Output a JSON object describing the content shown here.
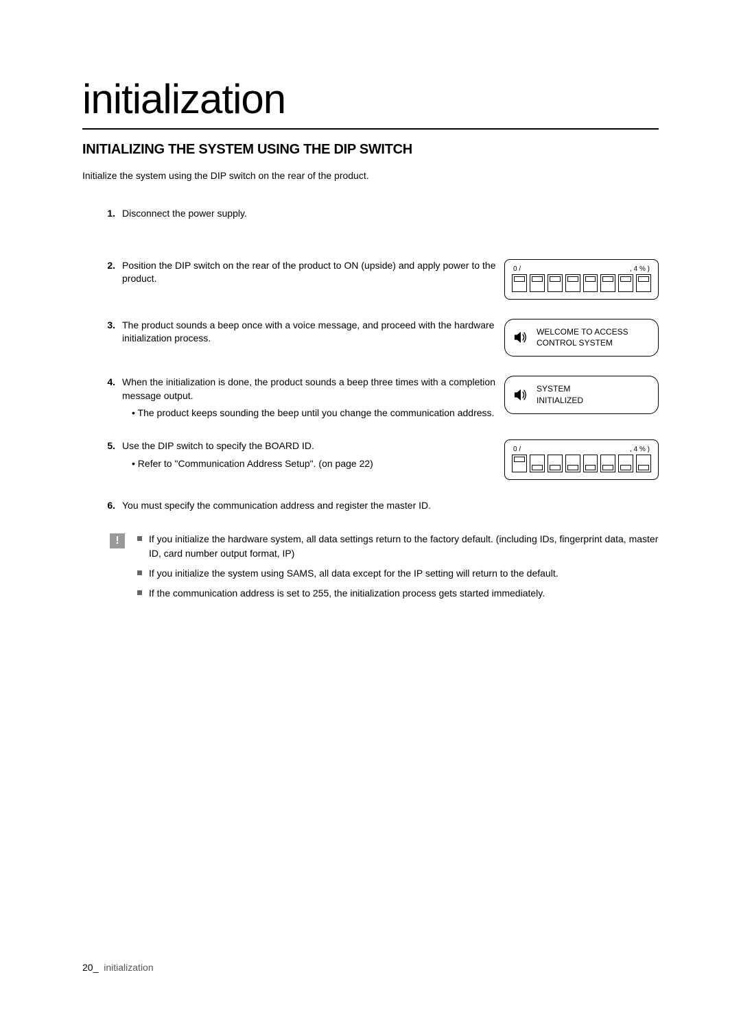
{
  "page": {
    "title": "initialization",
    "section_heading": "INITIALIZING THE SYSTEM USING THE DIP SWITCH",
    "intro": "Initialize the system using the DIP switch on the rear of the product."
  },
  "steps": [
    {
      "num": "1.",
      "text": "Disconnect the power supply."
    },
    {
      "num": "2.",
      "text": "Position the DIP switch on the rear of the product to ON (upside) and apply power to the product."
    },
    {
      "num": "3.",
      "text": "The product sounds a beep once with a voice message, and proceed with the hardware initialization process."
    },
    {
      "num": "4.",
      "text": "When the initialization is done, the product sounds a beep three times with a completion message output.",
      "bullet": "• The product keeps sounding the beep until you change the communication address."
    },
    {
      "num": "5.",
      "text": "Use the DIP switch to specify the BOARD ID.",
      "bullet": "• Refer to \"Communication Address Setup\". (on page 22)"
    },
    {
      "num": "6.",
      "text": "You must specify the communication address and register the master ID."
    }
  ],
  "dip1": {
    "label_left": "0 /",
    "label_right": ", 4 %      )",
    "positions": [
      "up",
      "up",
      "up",
      "up",
      "up",
      "up",
      "up",
      "up"
    ]
  },
  "msg1": {
    "line1": "WELCOME TO ACCESS",
    "line2": "CONTROL SYSTEM"
  },
  "msg2": {
    "line1": "SYSTEM",
    "line2": "INITIALIZED"
  },
  "dip2": {
    "label_left": "0 /",
    "label_right": ", 4 %      )",
    "positions": [
      "up",
      "down",
      "down",
      "down",
      "down",
      "down",
      "down",
      "down"
    ]
  },
  "notes": [
    {
      "text": "If you initialize the hardware system, all data settings return to the factory default. (including IDs, fingerprint data, master ID, card number output format, IP)"
    },
    {
      "text": "If you initialize the system using SAMS, all data except for the IP setting will return to the default."
    },
    {
      "text": "If the communication address is set to 255, the initialization process gets started immediately."
    }
  ],
  "footer": {
    "page_num": "20_",
    "label": "initialization"
  }
}
